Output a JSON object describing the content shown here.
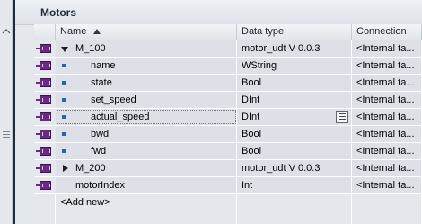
{
  "panel": {
    "title": "Motors"
  },
  "columns": {
    "name": "Name",
    "data_type": "Data type",
    "connection": "Connection"
  },
  "rows": [
    {
      "name": "M_100",
      "type": "motor_udt V 0.0.3",
      "conn": "<Internal ta..."
    },
    {
      "name": "name",
      "type": "WString",
      "conn": "<Internal ta..."
    },
    {
      "name": "state",
      "type": "Bool",
      "conn": "<Internal ta..."
    },
    {
      "name": "set_speed",
      "type": "DInt",
      "conn": "<Internal ta..."
    },
    {
      "name": "actual_speed",
      "type": "DInt",
      "conn": "<Internal ta..."
    },
    {
      "name": "bwd",
      "type": "Bool",
      "conn": "<Internal ta..."
    },
    {
      "name": "fwd",
      "type": "Bool",
      "conn": "<Internal ta..."
    },
    {
      "name": "M_200",
      "type": "motor_udt V 0.0.3",
      "conn": "<Internal ta..."
    },
    {
      "name": "motorIndex",
      "type": "Int",
      "conn": "<Internal ta..."
    }
  ],
  "add_new": "<Add new>",
  "icons": {
    "tag": "tag-icon",
    "sort": "sort-ascending-icon",
    "expand_open": "chevron-down-icon",
    "expand_closed": "chevron-right-icon",
    "member": "member-bullet-icon",
    "popup": "list-popup-icon"
  }
}
